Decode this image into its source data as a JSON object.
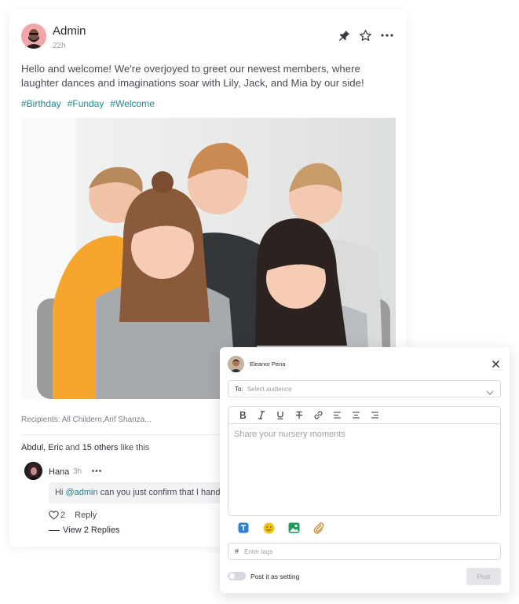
{
  "post": {
    "author": "Admin",
    "time": "22h",
    "text": "Hello and welcome! We're overjoyed to greet our newest members, where laughter dances and imaginations soar with Lily, Jack, and Mia by our side!",
    "hashtags": [
      "#Birthday",
      "#Funday",
      "#Welcome"
    ],
    "image_icon": "photo-of-five-children",
    "recipients": "Recipients: All Childern,Arif Shanza...",
    "likes": {
      "names": "Abdul, Eric",
      "and": "and",
      "others": "15 others",
      "suffix": "like this"
    },
    "comment": {
      "author": "Hana",
      "time": "3h",
      "text_before": "Hi ",
      "mention": "@admin",
      "text_after": " can you just confirm that I hand",
      "like_count": "2",
      "reply_label": "Reply",
      "view_replies": "View 2 Replies"
    }
  },
  "composer": {
    "user_name": "Eleanor Pena",
    "audience_label": "To:",
    "audience_placeholder": "Select audience",
    "editor_placeholder": "Share your nursery moments",
    "toolbar": [
      "bold-icon",
      "italic-icon",
      "underline-icon",
      "strikethrough-icon",
      "link-icon",
      "align-left-icon",
      "align-center-icon",
      "align-right-icon"
    ],
    "attachments": [
      "text-icon",
      "emoji-icon",
      "image-icon",
      "paperclip-icon"
    ],
    "tags_hash": "#",
    "tags_placeholder": "Enter tags",
    "toggle_label": "Post it as setting",
    "post_label": "Post"
  },
  "colors": {
    "accent": "#1e8a8e",
    "text_primary": "#2a2a33",
    "muted": "#9a9aa3"
  }
}
